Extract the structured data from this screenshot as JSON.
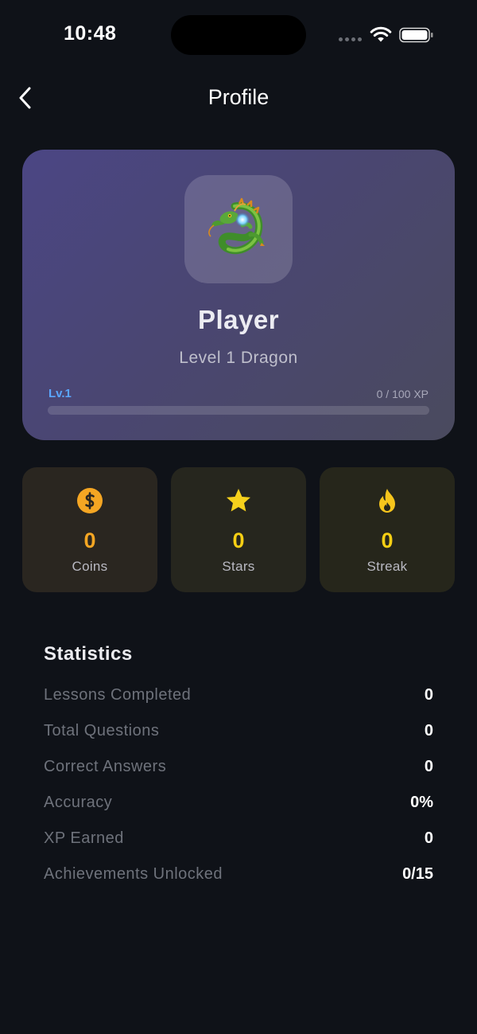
{
  "status_bar": {
    "time": "10:48"
  },
  "header": {
    "title": "Profile"
  },
  "profile": {
    "name": "Player",
    "level_text": "Level 1 Dragon",
    "level_short": "Lv.1",
    "xp_text": "0 / 100 XP",
    "xp_progress": 0,
    "avatar_icon": "dragon-icon"
  },
  "tiles": {
    "coins": {
      "value": "0",
      "label": "Coins",
      "icon": "coin-icon",
      "color": "#f5a623"
    },
    "stars": {
      "value": "0",
      "label": "Stars",
      "icon": "star-icon",
      "color": "#f6cf14"
    },
    "streak": {
      "value": "0",
      "label": "Streak",
      "icon": "flame-icon",
      "color": "#f6cf14"
    }
  },
  "statistics": {
    "title": "Statistics",
    "rows": [
      {
        "label": "Lessons Completed",
        "value": "0"
      },
      {
        "label": "Total Questions",
        "value": "0"
      },
      {
        "label": "Correct Answers",
        "value": "0"
      },
      {
        "label": "Accuracy",
        "value": "0%"
      },
      {
        "label": "XP Earned",
        "value": "0"
      },
      {
        "label": "Achievements Unlocked",
        "value": "0/15"
      }
    ]
  },
  "colors": {
    "background": "#0f1218",
    "accent_blue": "#5aa6ff",
    "card_gradient_start": "#4b4684"
  }
}
